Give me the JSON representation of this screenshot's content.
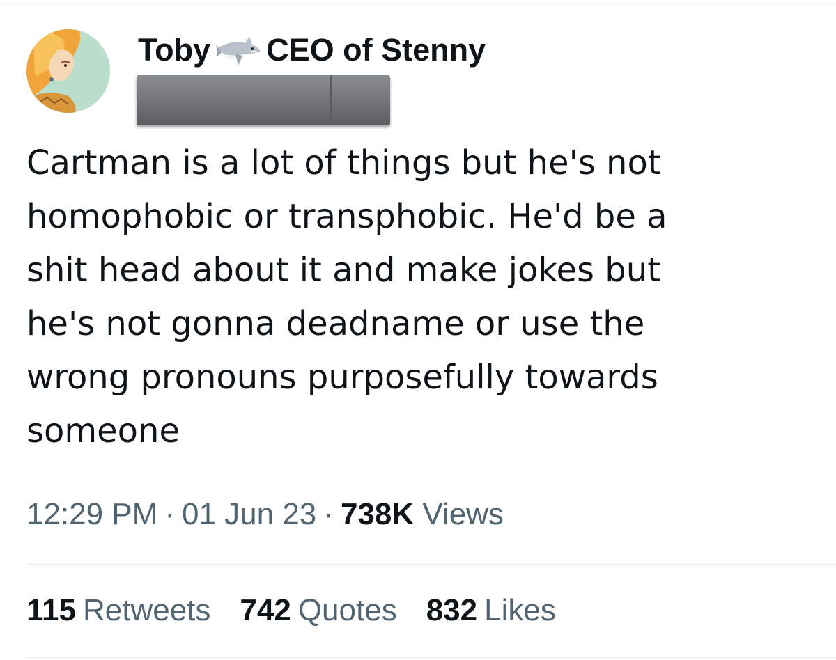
{
  "author": {
    "display_name_part1": "Toby",
    "display_name_emoji": "shark-emoji-icon",
    "display_name_part2": "CEO of Stenny",
    "handle": "",
    "avatar": "avatar-illustration"
  },
  "tweet": {
    "text": "Cartman is a lot of things but he's not\nhomophobic or transphobic. He'd be a\nshit head about it and make jokes but\nhe's not gonna deadname or use the\nwrong pronouns purposefully towards\nsomeone"
  },
  "meta": {
    "time": "12:29 PM",
    "separator": "·",
    "date": "01 Jun 23",
    "views_count": "738K",
    "views_label": "Views"
  },
  "stats": {
    "retweets_count": "115",
    "retweets_label": "Retweets",
    "quotes_count": "742",
    "quotes_label": "Quotes",
    "likes_count": "832",
    "likes_label": "Likes"
  },
  "colors": {
    "text_primary": "#0f1419",
    "text_secondary": "#536471",
    "divider": "#e6ecf0"
  }
}
